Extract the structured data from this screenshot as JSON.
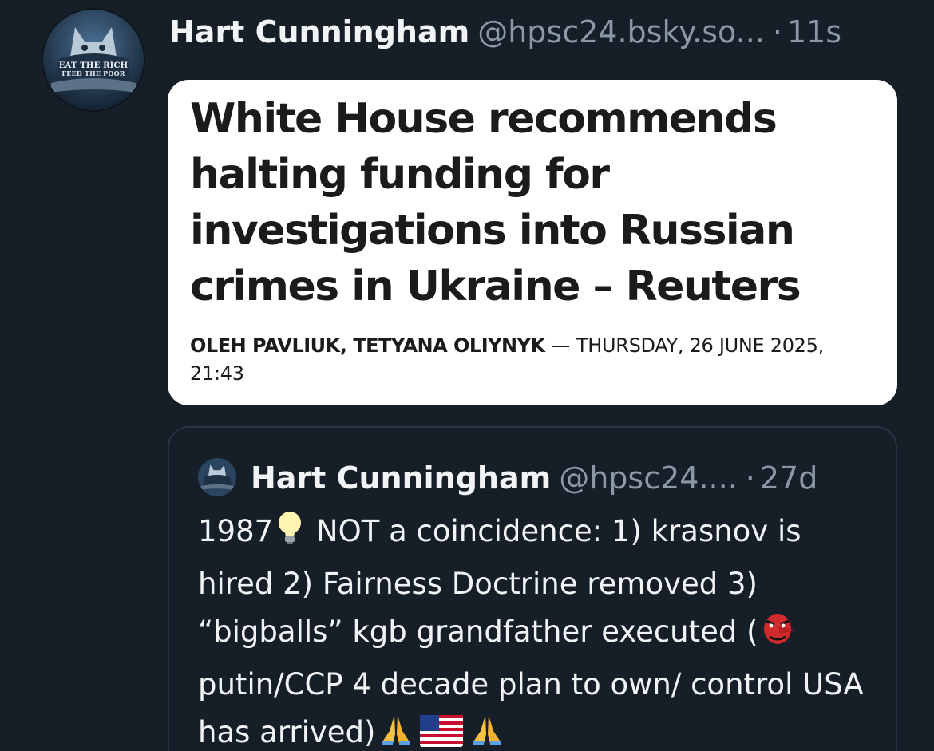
{
  "post": {
    "author_name": "Hart Cunningham",
    "author_handle": "@hpsc24.bsky.so...",
    "separator": "·",
    "timestamp": "11s",
    "avatar": {
      "line1": "EAT THE RICH",
      "line2": "FEED THE POOR"
    }
  },
  "article": {
    "title": "White House recommends halting funding for investigations into Russian crimes in Ukraine – Reuters",
    "byline_authors": "OLEH PAVLIUK, TETYANA OLIYNYK",
    "byline_dash": " — ",
    "byline_date": "THURSDAY, 26 JUNE 2025, 21:43"
  },
  "quote": {
    "author_name": "Hart Cunningham",
    "author_handle": "@hpsc24....",
    "separator": "·",
    "timestamp": "27d",
    "text_1": "1987",
    "text_2": " NOT a coincidence: 1) krasnov is hired 2) Fairness Doctrine removed 3) “bigballs” kgb grandfather executed (",
    "text_3": "putin/CCP 4 decade plan to own/ control USA has arrived)",
    "emojis": [
      "light-bulb-icon",
      "tengu-mask-icon",
      "folded-hands-icon",
      "us-flag-icon",
      "folded-hands-icon"
    ]
  },
  "colors": {
    "background": "#161e27",
    "text": "#f1f3f5",
    "muted": "#8b98a5",
    "card": "#ffffff",
    "border": "#2a3541"
  }
}
